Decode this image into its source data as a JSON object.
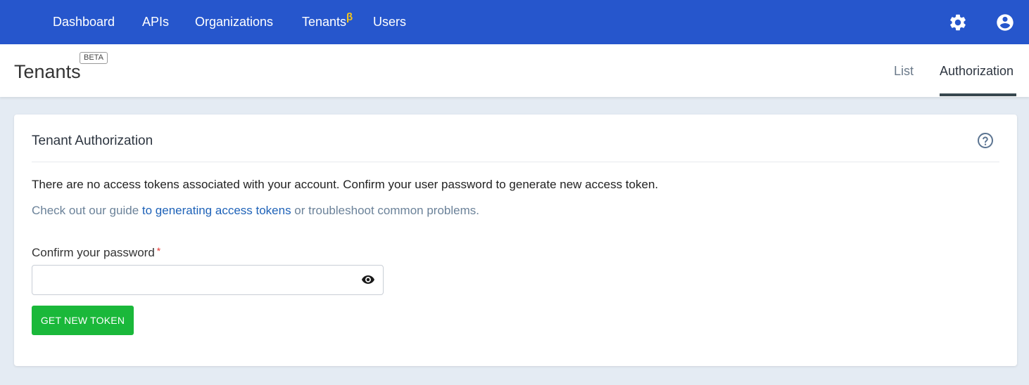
{
  "nav": {
    "items": [
      {
        "label": "Dashboard"
      },
      {
        "label": "APIs"
      },
      {
        "label": "Organizations"
      },
      {
        "label": "Tenants",
        "superscript": "β"
      },
      {
        "label": "Users"
      }
    ],
    "icons": [
      "gear-icon",
      "account-circle-icon"
    ]
  },
  "header": {
    "title": "Tenants",
    "badge": "BETA",
    "tabs": [
      {
        "label": "List",
        "active": false
      },
      {
        "label": "Authorization",
        "active": true
      }
    ]
  },
  "card": {
    "title": "Tenant Authorization",
    "help_icon": "question-circle-icon",
    "message": "There are no access tokens associated with your account. Confirm your user password to generate new access token.",
    "guide_prefix": "Check out our guide ",
    "guide_link": "to generating access tokens",
    "guide_suffix": " or troubleshoot common problems.",
    "field_label": "Confirm your password",
    "required_mark": "*",
    "password_value": "",
    "eye_icon": "eye-icon",
    "button_label": "GET NEW TOKEN"
  },
  "colors": {
    "nav_bg": "#2656cc",
    "page_bg": "#e4ebf3",
    "button_bg": "#1ab83a",
    "link": "#1e62b8",
    "beta_accent": "#f5c518"
  }
}
